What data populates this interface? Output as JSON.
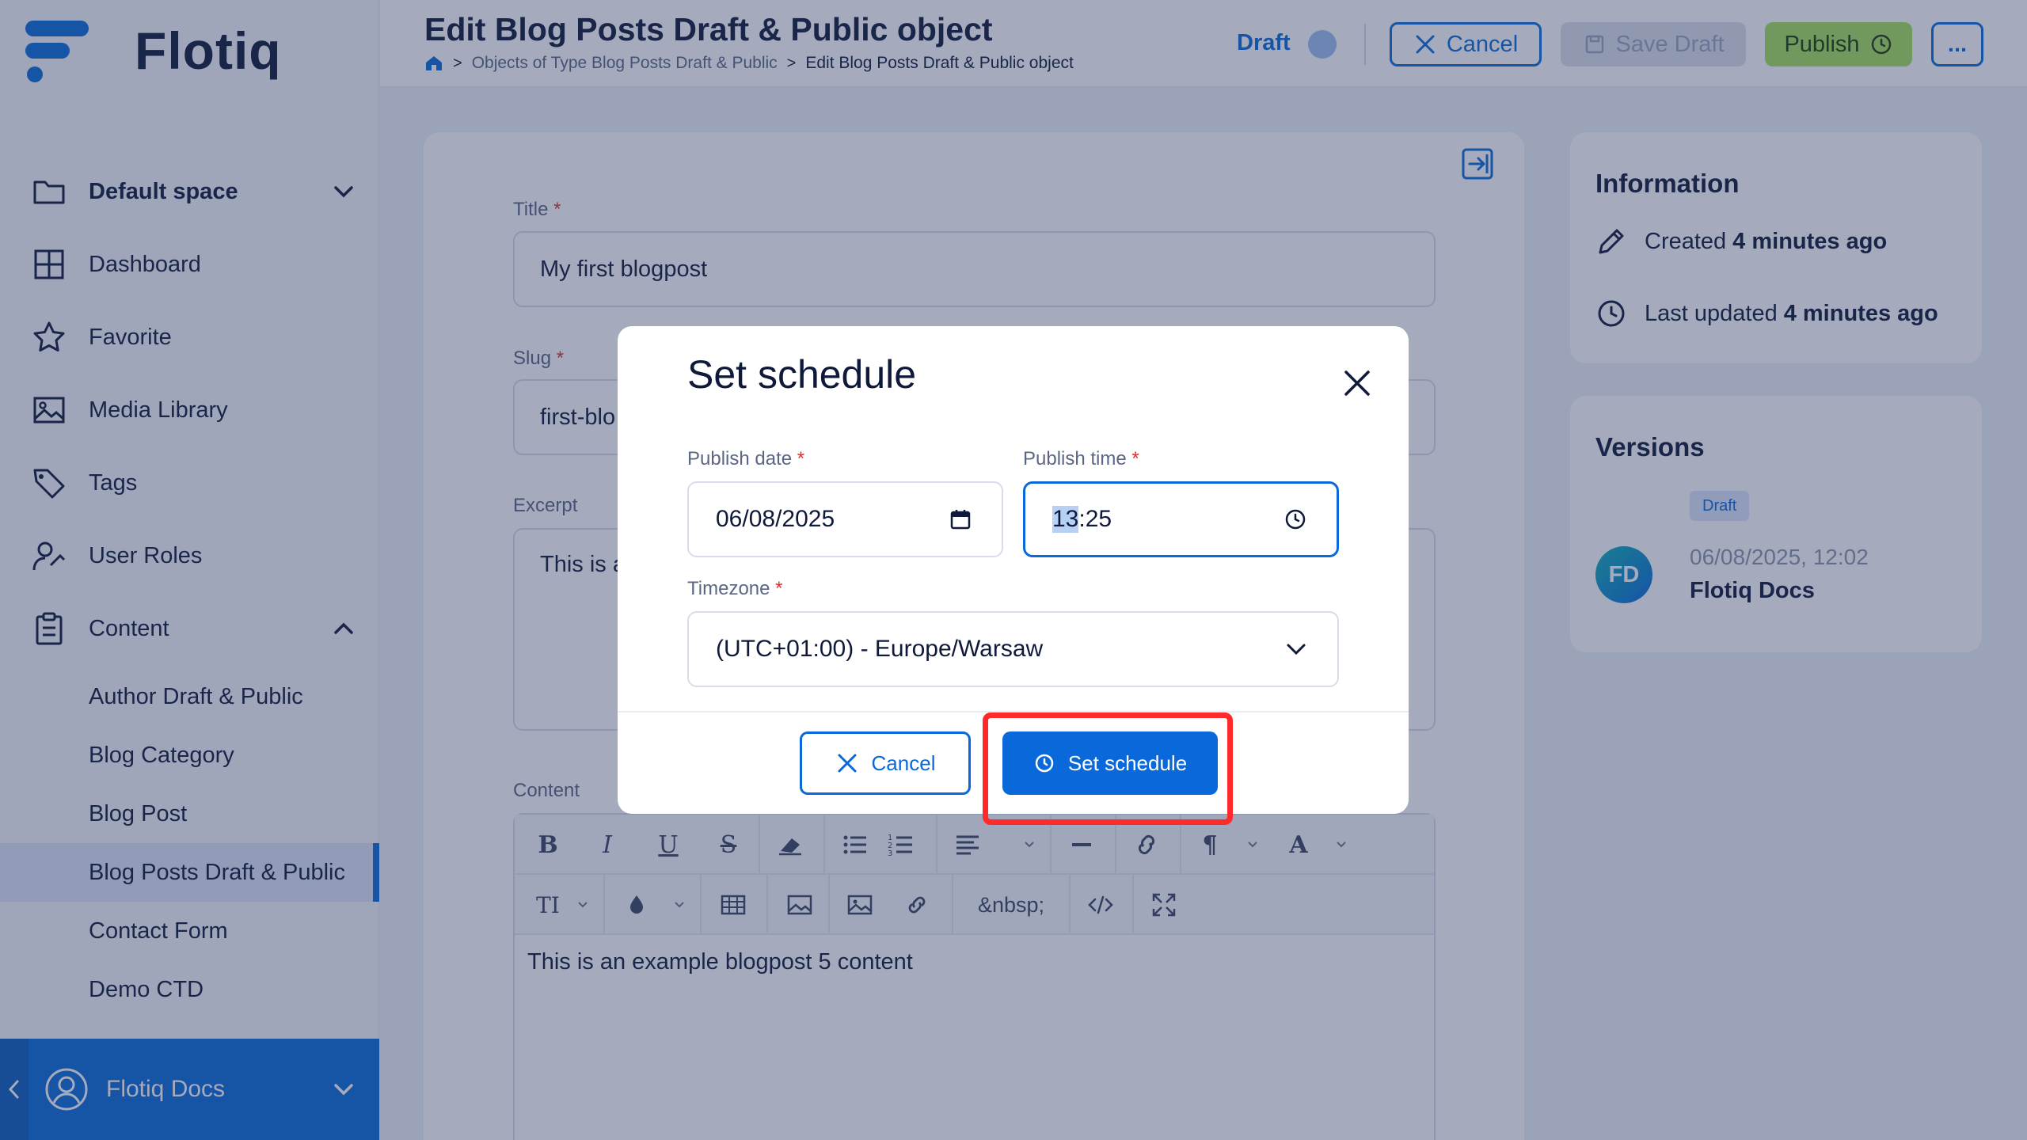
{
  "brand": {
    "name": "Flotiq"
  },
  "sidebar": {
    "space": "Default space",
    "items": [
      {
        "label": "Dashboard"
      },
      {
        "label": "Favorite"
      },
      {
        "label": "Media Library"
      },
      {
        "label": "Tags"
      },
      {
        "label": "User Roles"
      },
      {
        "label": "Content"
      }
    ],
    "content_types": [
      {
        "label": "Author Draft & Public"
      },
      {
        "label": "Blog Category"
      },
      {
        "label": "Blog Post"
      },
      {
        "label": "Blog Posts Draft & Public",
        "active": true
      },
      {
        "label": "Contact Form"
      },
      {
        "label": "Demo CTD"
      }
    ],
    "user": "Flotiq Docs"
  },
  "header": {
    "title": "Edit Blog Posts Draft & Public object",
    "breadcrumb": [
      "Objects of Type Blog Posts Draft & Public",
      "Edit Blog Posts Draft & Public object"
    ],
    "status": "Draft",
    "cancel_label": "Cancel",
    "save_label": "Save Draft",
    "publish_label": "Publish",
    "more_label": "..."
  },
  "form": {
    "title_label": "Title",
    "title_value": "My first blogpost",
    "slug_label": "Slug",
    "slug_value": "first-blo",
    "excerpt_label": "Excerpt",
    "excerpt_value": "This is a",
    "content_label": "Content",
    "content_value": "This is an example blogpost 5 content",
    "required_mark": "*",
    "toolbar": {
      "bold": "B",
      "italic": "I",
      "underline": "U",
      "strike": "S",
      "paragraph": "¶",
      "font": "A",
      "text_size": "TI",
      "nbsp": "&nbsp;"
    }
  },
  "info": {
    "title": "Information",
    "created_label": "Created",
    "created_value": "4 minutes ago",
    "updated_label": "Last updated",
    "updated_value": "4 minutes ago"
  },
  "versions": {
    "title": "Versions",
    "badge": "Draft",
    "avatar_initials": "FD",
    "date": "06/08/2025, 12:02",
    "author": "Flotiq Docs"
  },
  "modal": {
    "title": "Set schedule",
    "date_label": "Publish date",
    "date_value": "06/08/2025",
    "time_label": "Publish time",
    "time_hour": "13",
    "time_rest": ":25",
    "timezone_label": "Timezone",
    "timezone_value": "(UTC+01:00) - Europe/Warsaw",
    "cancel_label": "Cancel",
    "submit_label": "Set schedule"
  },
  "colors": {
    "accent": "#0a69da",
    "publish": "#a7e05c",
    "highlight": "#ff2a2a",
    "required": "#e02d2d"
  }
}
